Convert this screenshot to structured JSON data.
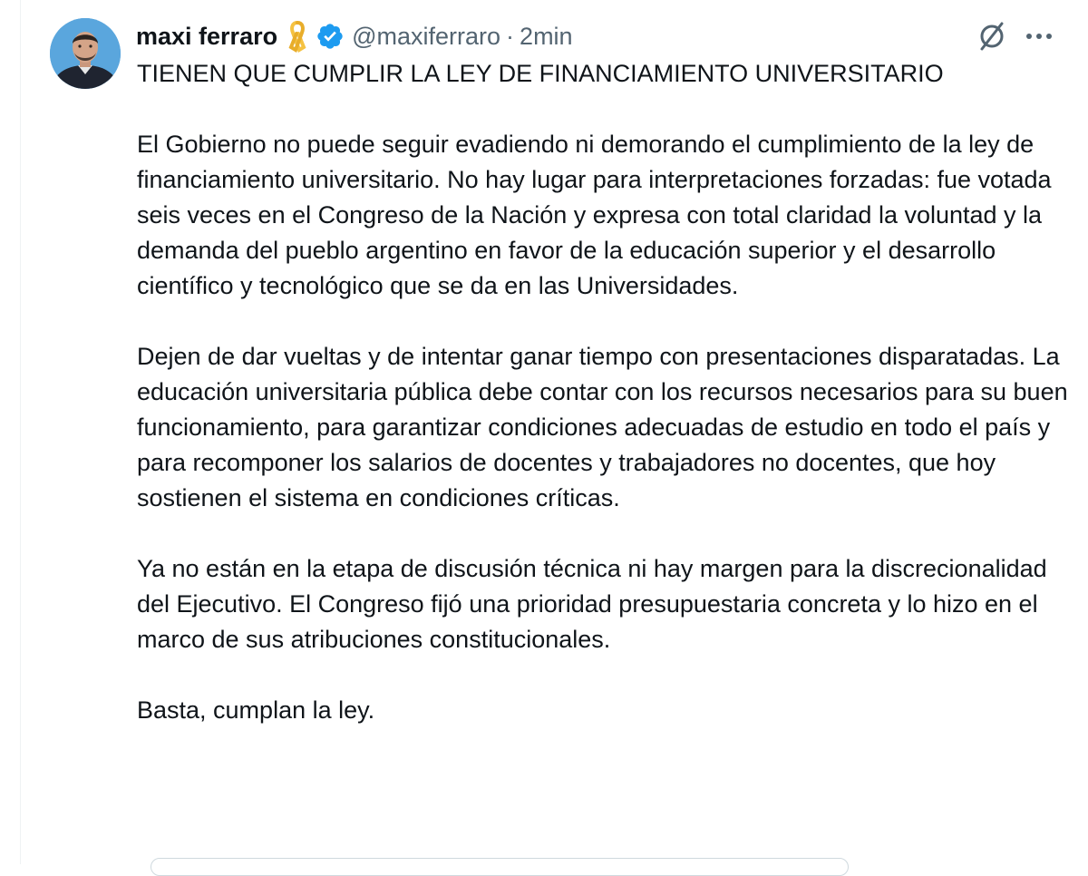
{
  "author": {
    "name": "maxi ferraro",
    "handle": "@maxiferraro",
    "separator": "·",
    "time": "2min"
  },
  "icons": {
    "avatar": "profile-photo",
    "ribbon": "yellow-ribbon-icon",
    "verified": "verified-badge-icon",
    "grok": "grok-icon",
    "more": "more-options-icon"
  },
  "colors": {
    "verified": "#1d9bf0",
    "ribbon": "#f5c242",
    "secondary_text": "#536471",
    "primary_text": "#0f1419"
  },
  "tweet": {
    "paragraphs": [
      "TIENEN QUE CUMPLIR LA LEY DE FINANCIAMIENTO UNIVERSITARIO",
      "El Gobierno no puede seguir evadiendo ni demorando el cumplimiento de la ley de financiamiento universitario. No hay lugar para interpretaciones forzadas: fue votada seis veces en el Congreso de la Nación y expresa con total claridad la voluntad y la demanda del pueblo argentino en favor de la educación superior y el desarrollo científico y tecnológico que se da en las Universidades.",
      "Dejen de dar vueltas y de intentar ganar tiempo con presentaciones disparatadas. La educación universitaria pública debe contar con los recursos necesarios para su buen funcionamiento, para garantizar condiciones adecuadas de estudio en todo el país y para recomponer los salarios de docentes y trabajadores no docentes, que hoy sostienen el sistema en condiciones críticas.",
      "Ya no están en la etapa de discusión técnica ni hay margen para la discrecionalidad del Ejecutivo. El Congreso fijó una prioridad presupuestaria concreta y lo hizo en el marco de sus atribuciones constitucionales.",
      "Basta, cumplan la ley."
    ]
  }
}
